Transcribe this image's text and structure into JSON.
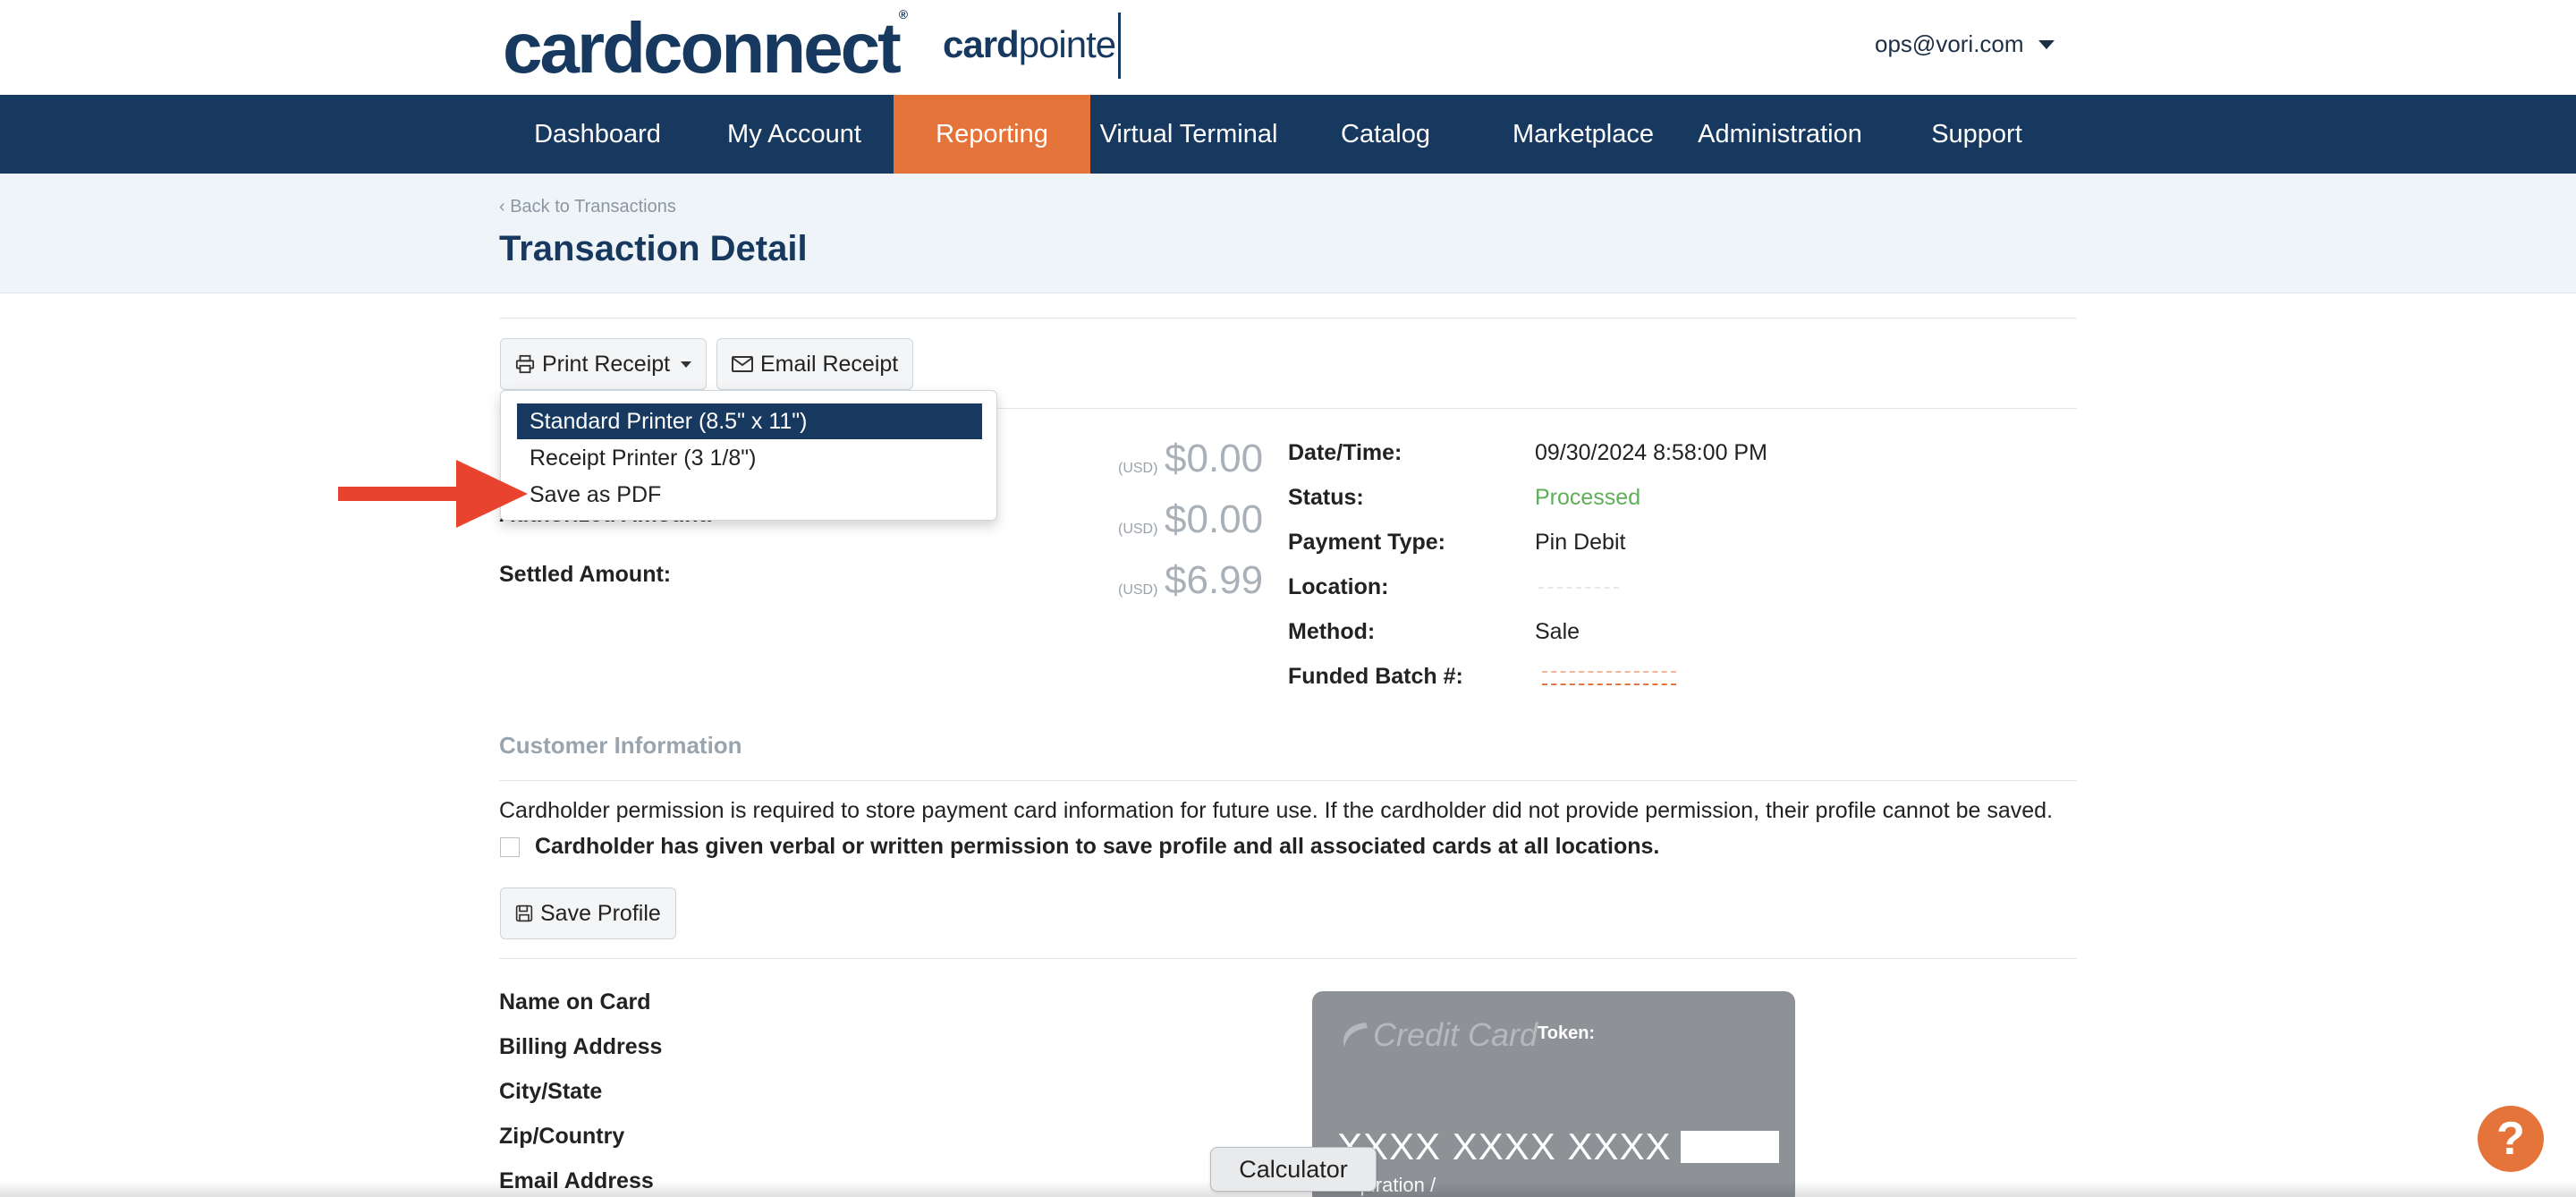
{
  "header": {
    "logo_main": "cardconnect",
    "logo_tm": "®",
    "logo_sub_bold": "card",
    "logo_sub_rest": "pointe",
    "user_email": "ops@vori.com"
  },
  "nav": {
    "items": [
      {
        "label": "Dashboard"
      },
      {
        "label": "My Account"
      },
      {
        "label": "Reporting"
      },
      {
        "label": "Virtual Terminal"
      },
      {
        "label": "Catalog"
      },
      {
        "label": "Marketplace"
      },
      {
        "label": "Administration"
      },
      {
        "label": "Support"
      }
    ],
    "active": "Reporting"
  },
  "page": {
    "back_link": "‹  Back to Transactions",
    "title": "Transaction Detail"
  },
  "toolbar": {
    "print_label": "Print Receipt",
    "email_label": "Email Receipt"
  },
  "print_menu": {
    "items": [
      {
        "label": "Standard Printer (8.5\" x 11\")"
      },
      {
        "label": "Receipt Printer (3 1/8\")"
      },
      {
        "label": "Save as PDF"
      }
    ],
    "selected_index": 0
  },
  "amounts": {
    "authorized_label": "Authorized Amount:",
    "settled_label": "Settled Amount:",
    "currency": "(USD)",
    "values": [
      "$0.00",
      "$0.00",
      "$6.99"
    ]
  },
  "details": {
    "rows": [
      {
        "label": "Date/Time:",
        "value": "09/30/2024 8:58:00 PM"
      },
      {
        "label": "Status:",
        "value": "Processed"
      },
      {
        "label": "Payment Type:",
        "value": "Pin Debit"
      },
      {
        "label": "Location:",
        "value": ""
      },
      {
        "label": "Method:",
        "value": "Sale"
      },
      {
        "label": "Funded Batch #:",
        "value": ""
      }
    ]
  },
  "customer": {
    "section_title": "Customer Information",
    "permission_text": "Cardholder permission is required to store payment card information for future use. If the cardholder did not provide permission, their profile cannot be saved.",
    "checkbox_label": "Cardholder has given verbal or written permission to save profile and all associated cards at all locations.",
    "checkbox_checked": false,
    "save_profile_label": "Save Profile",
    "fields": [
      {
        "label": "Name on Card"
      },
      {
        "label": "Billing Address"
      },
      {
        "label": "City/State"
      },
      {
        "label": "Zip/Country"
      },
      {
        "label": "Email Address"
      }
    ]
  },
  "card": {
    "brand": "Credit Card",
    "token_label": "Token:",
    "number_masked": "XXXX XXXX XXXX",
    "expiration": "Expiration  /"
  },
  "widgets": {
    "calculator_label": "Calculator",
    "help_label": "?"
  },
  "colors": {
    "brand_navy": "#17385f",
    "accent_orange": "#e5743a",
    "status_green": "#5fae58",
    "annotation_red": "#e8432f"
  }
}
